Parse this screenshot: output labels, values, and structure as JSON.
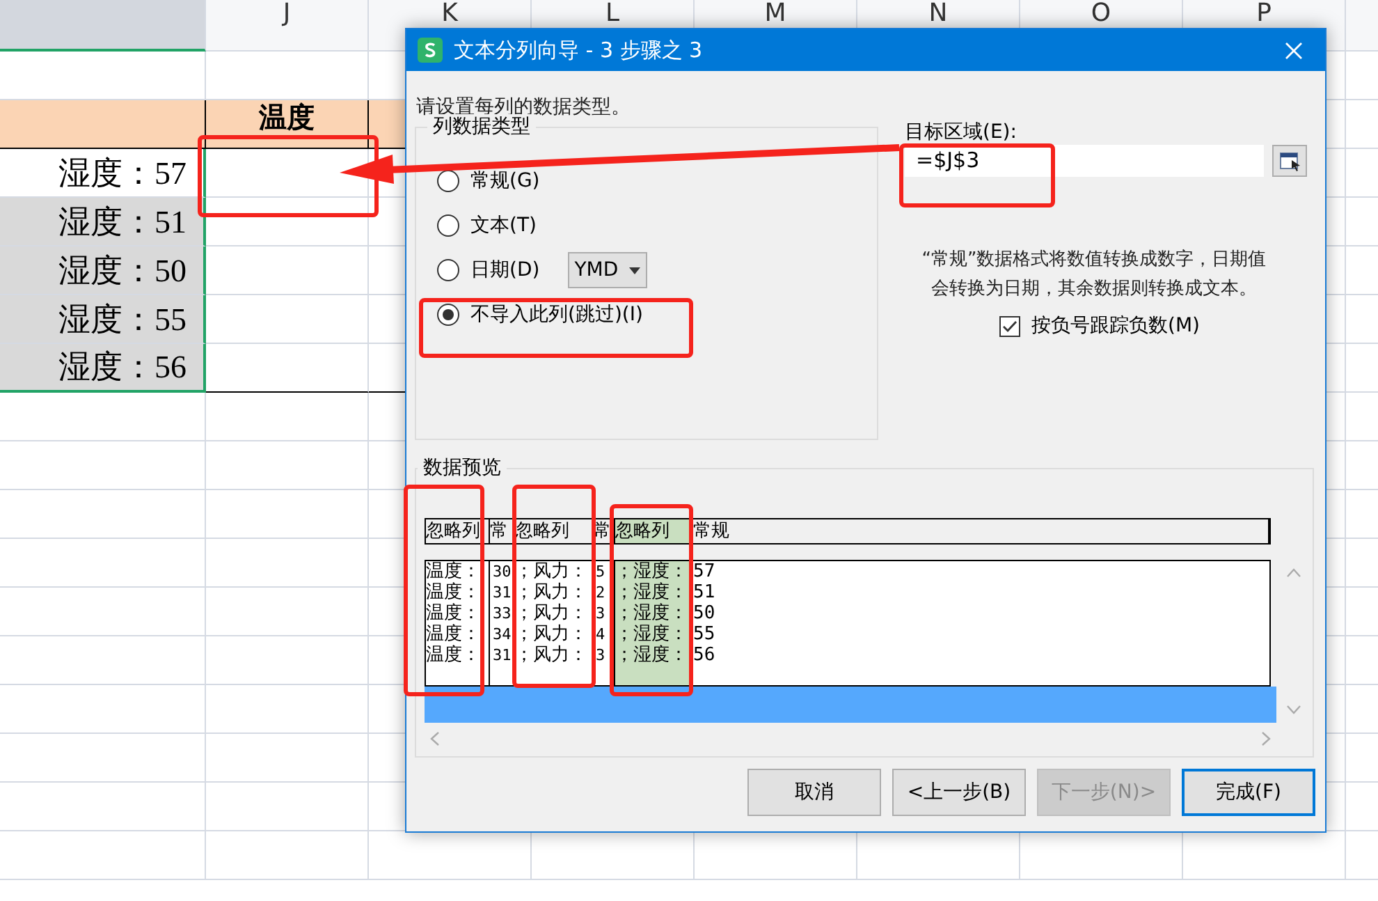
{
  "sheet": {
    "columns": [
      {
        "selected": true
      },
      {
        "label": "J",
        "selected": false
      },
      {
        "label": "K",
        "selected": false
      },
      {
        "label": "L",
        "selected": false
      },
      {
        "label": "M",
        "selected": false
      },
      {
        "label": "N",
        "selected": false
      },
      {
        "label": "O",
        "selected": false
      },
      {
        "label": "P",
        "selected": false
      },
      {
        "selected": false
      }
    ],
    "header_cell": "温度",
    "cells": [
      {
        "text": "湿度：57",
        "selected": false
      },
      {
        "text": "湿度：51",
        "selected": true
      },
      {
        "text": "湿度：50",
        "selected": true
      },
      {
        "text": "湿度：55",
        "selected": true
      },
      {
        "text": "湿度：56",
        "selected": true
      }
    ]
  },
  "dialog": {
    "title": "文本分列向导 - 3 步骤之 3",
    "instruction": "请设置每列的数据类型。",
    "type_group": {
      "title": "列数据类型",
      "options": [
        {
          "label": "常规(G)",
          "selected": false
        },
        {
          "label": "文本(T)",
          "selected": false
        },
        {
          "label": "日期(D)",
          "selected": false,
          "dropdown": "YMD"
        },
        {
          "label": "不导入此列(跳过)(I)",
          "selected": true
        }
      ]
    },
    "target": {
      "label": "目标区域(E):",
      "value": "=$J$3"
    },
    "note": "“常规”数据格式将数值转换成数字，日期值会转换为日期，其余数据则转换成文本。",
    "checkbox": {
      "label": "按负号跟踪负数(M)",
      "checked": true
    },
    "preview": {
      "title": "数据预览",
      "columns": [
        {
          "header": "忽略列",
          "selected": false
        },
        {
          "header": "常",
          "selected": false
        },
        {
          "header": "忽略列",
          "selected": false
        },
        {
          "header": "常",
          "selected": false
        },
        {
          "header": "忽略列",
          "selected": true
        },
        {
          "header": "常规",
          "selected": false
        }
      ],
      "rows": [
        [
          "温度：",
          "30",
          "；风力：",
          "5",
          "；湿度：",
          "57"
        ],
        [
          "温度：",
          "31",
          "；风力：",
          "2",
          "；湿度：",
          "51"
        ],
        [
          "温度：",
          "33",
          "；风力：",
          "3",
          "；湿度：",
          "50"
        ],
        [
          "温度：",
          "34",
          "；风力：",
          "4",
          "；湿度：",
          "55"
        ],
        [
          "温度：",
          "31",
          "；风力：",
          "3",
          "；湿度：",
          "56"
        ]
      ]
    },
    "buttons": [
      {
        "label": "取消",
        "kind": "normal"
      },
      {
        "label": "<上一步(B)",
        "kind": "normal"
      },
      {
        "label": "下一步(N)>",
        "kind": "disabled"
      },
      {
        "label": "完成(F)",
        "kind": "default"
      }
    ]
  }
}
